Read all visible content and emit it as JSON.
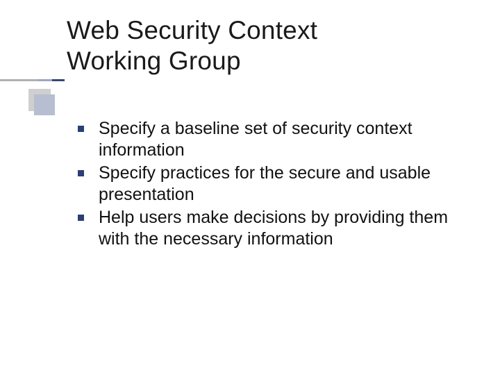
{
  "title_line1": "Web Security Context",
  "title_line2": "Working Group",
  "bullets": [
    "Specify a baseline set of security context information",
    "Specify practices for the secure and usable presentation",
    "Help users make decisions by providing them with the necessary information"
  ]
}
